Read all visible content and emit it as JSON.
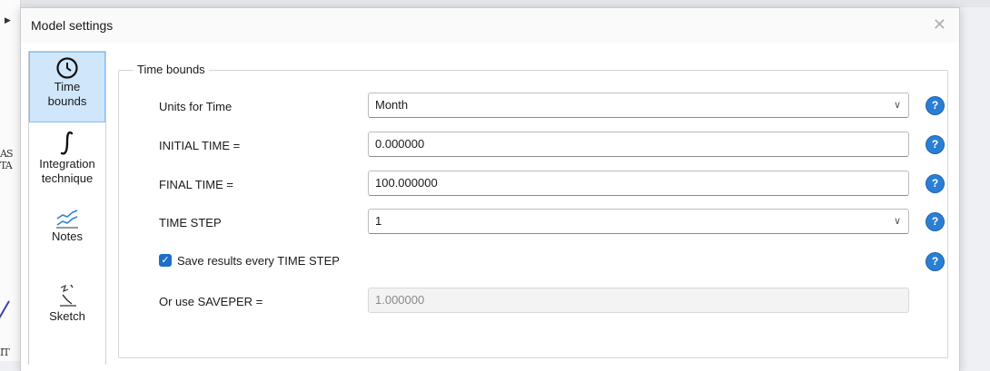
{
  "background": {
    "text_lines": [
      "AS",
      "TA",
      "IT"
    ]
  },
  "dialog": {
    "title": "Model settings",
    "close_glyph": "✕"
  },
  "nav": {
    "items": [
      {
        "label_line1": "Time",
        "label_line2": "bounds",
        "icon": "clock-icon",
        "active": true
      },
      {
        "label_line1": "Integration",
        "label_line2": "technique",
        "icon": "integral-icon",
        "active": false
      },
      {
        "label_line1": "Notes",
        "label_line2": "",
        "icon": "notes-chart-icon",
        "active": false
      },
      {
        "label_line1": "Sketch",
        "label_line2": "",
        "icon": "sketch-icon",
        "active": false
      }
    ]
  },
  "time_bounds": {
    "legend": "Time bounds",
    "units_label": "Units for Time",
    "units_value": "Month",
    "initial_label": "INITIAL TIME =",
    "initial_value": "0.000000",
    "final_label": "FINAL TIME =",
    "final_value": "100.000000",
    "step_label": "TIME STEP",
    "step_value": "1",
    "save_label": "Save results every TIME STEP",
    "save_checked": true,
    "saveper_label": "Or use SAVEPER =",
    "saveper_value": "1.000000",
    "help_glyph": "?"
  },
  "colors": {
    "accent": "#2a7fd4",
    "active_nav_bg": "#cfe6fb"
  }
}
